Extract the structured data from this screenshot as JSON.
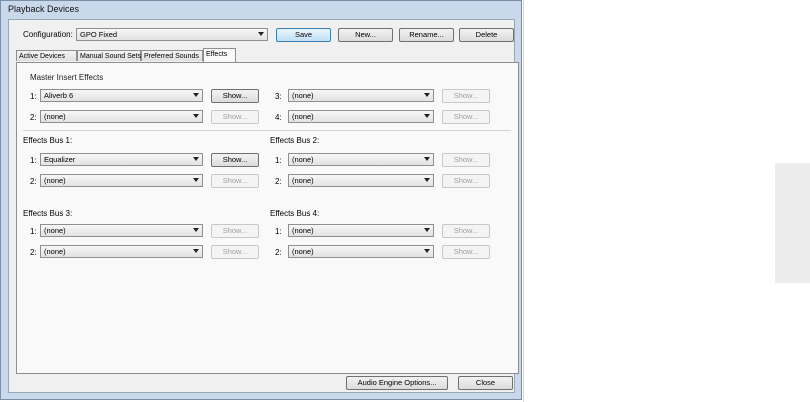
{
  "window": {
    "title": "Playback Devices"
  },
  "config": {
    "label": "Configuration:",
    "value": "GPO Fixed"
  },
  "topButtons": {
    "save": "Save",
    "new": "New...",
    "rename": "Rename...",
    "delete": "Delete"
  },
  "tabs": [
    "Active Devices",
    "Manual Sound Sets",
    "Preferred Sounds",
    "Effects"
  ],
  "master": {
    "title": "Master Insert Effects",
    "slots": [
      {
        "num": "1:",
        "value": "Aliverb 6",
        "show": "Show...",
        "enabled": true
      },
      {
        "num": "2:",
        "value": "(none)",
        "show": "Show...",
        "enabled": false
      },
      {
        "num": "3:",
        "value": "(none)",
        "show": "Show...",
        "enabled": false
      },
      {
        "num": "4:",
        "value": "(none)",
        "show": "Show...",
        "enabled": false
      }
    ]
  },
  "buses": [
    {
      "title": "Effects Bus 1:",
      "slots": [
        {
          "num": "1:",
          "value": "Equalizer",
          "show": "Show...",
          "enabled": true
        },
        {
          "num": "2:",
          "value": "(none)",
          "show": "Show...",
          "enabled": false
        }
      ]
    },
    {
      "title": "Effects Bus 2:",
      "slots": [
        {
          "num": "1:",
          "value": "(none)",
          "show": "Show...",
          "enabled": false
        },
        {
          "num": "2:",
          "value": "(none)",
          "show": "Show...",
          "enabled": false
        }
      ]
    },
    {
      "title": "Effects Bus 3:",
      "slots": [
        {
          "num": "1:",
          "value": "(none)",
          "show": "Show...",
          "enabled": false
        },
        {
          "num": "2:",
          "value": "(none)",
          "show": "Show...",
          "enabled": false
        }
      ]
    },
    {
      "title": "Effects Bus 4:",
      "slots": [
        {
          "num": "1:",
          "value": "(none)",
          "show": "Show...",
          "enabled": false
        },
        {
          "num": "2:",
          "value": "(none)",
          "show": "Show...",
          "enabled": false
        }
      ]
    }
  ],
  "bottomButtons": {
    "audioEngine": "Audio Engine Options...",
    "close": "Close"
  }
}
